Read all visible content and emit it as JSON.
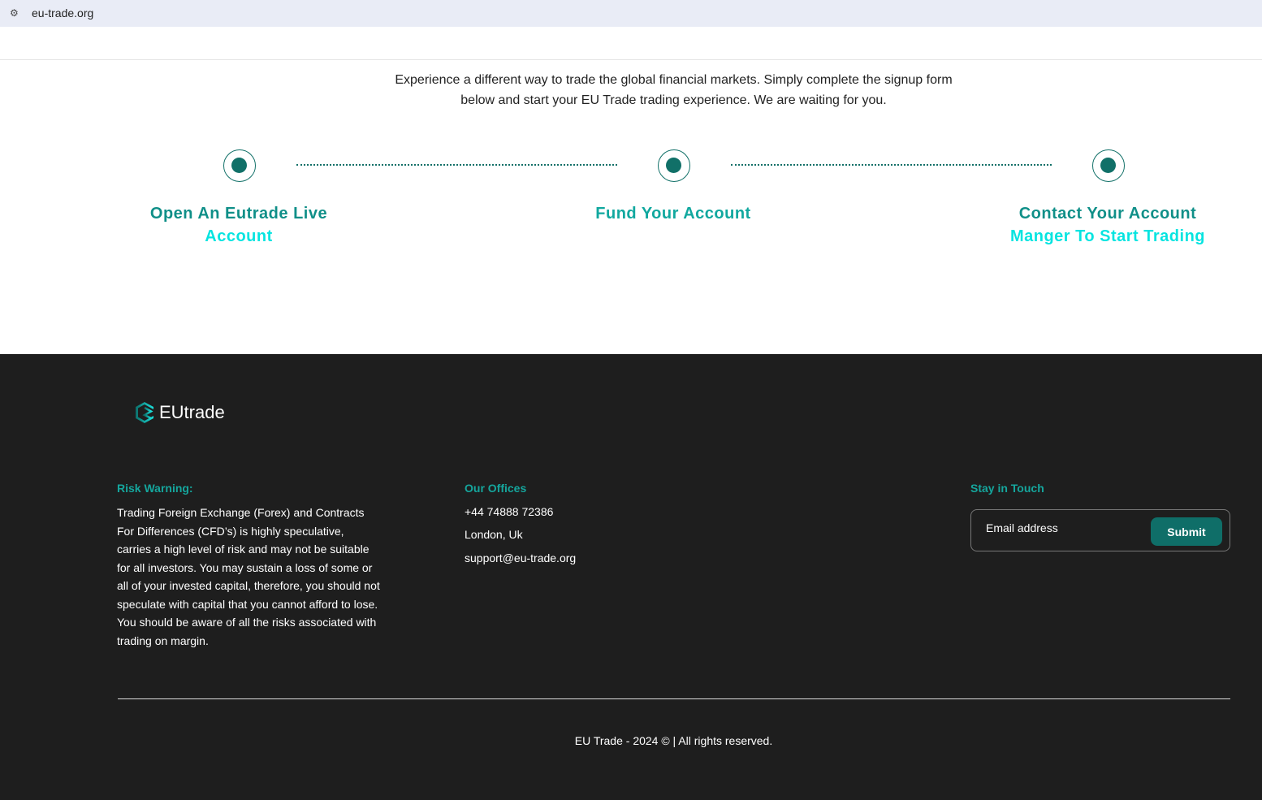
{
  "browser": {
    "url": "eu-trade.org"
  },
  "intro": {
    "line1": "Experience a different way to trade the global financial markets. Simply complete the signup form",
    "line2": "below and start your EU Trade trading experience. We are waiting for you."
  },
  "steps": [
    {
      "line1": "Open An Eutrade Live",
      "line2": "Account"
    },
    {
      "line1": "Fund Your Account"
    },
    {
      "line1": "Contact Your Account",
      "line2": "Manger To Start Trading"
    }
  ],
  "footer": {
    "logo": "EUtrade",
    "risk": {
      "title": "Risk Warning:",
      "text": "Trading Foreign Exchange (Forex) and Contracts For Differences (CFD’s) is highly speculative, carries a high level of risk and may not be suitable for all investors. You may sustain a loss of some or all of your invested capital, therefore, you should not speculate with capital that you cannot afford to lose. You should be aware of all the risks associated with trading on margin."
    },
    "offices": {
      "title": "Our Offices",
      "phone": "+44 74888 72386",
      "location": "London, Uk",
      "email": "support@eu-trade.org"
    },
    "touch": {
      "title": "Stay in Touch",
      "placeholder": "Email address",
      "submit": "Submit"
    },
    "copyright": "EU Trade - 2024 © | All rights reserved."
  }
}
